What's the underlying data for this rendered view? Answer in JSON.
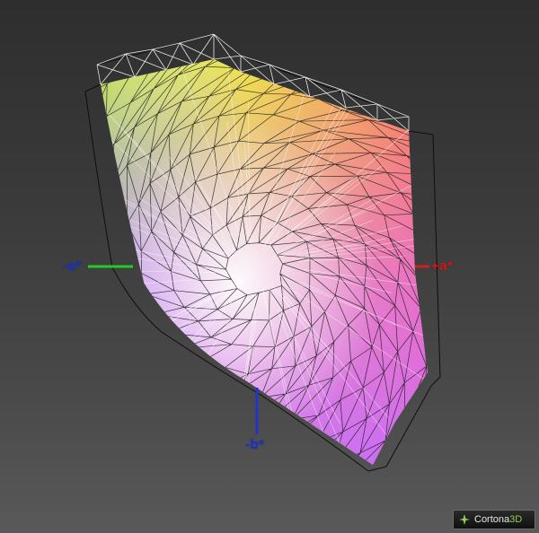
{
  "axes": {
    "neg_a": "-a*",
    "pos_a": "+a*",
    "neg_b": "-b*"
  },
  "axis_colors": {
    "a_negative": "#22cc22",
    "a_positive": "#cc2222",
    "b_negative": "#2233cc"
  },
  "brand": {
    "name": "Cortona",
    "suffix": "3D",
    "icon": "cortona-logo-icon"
  }
}
